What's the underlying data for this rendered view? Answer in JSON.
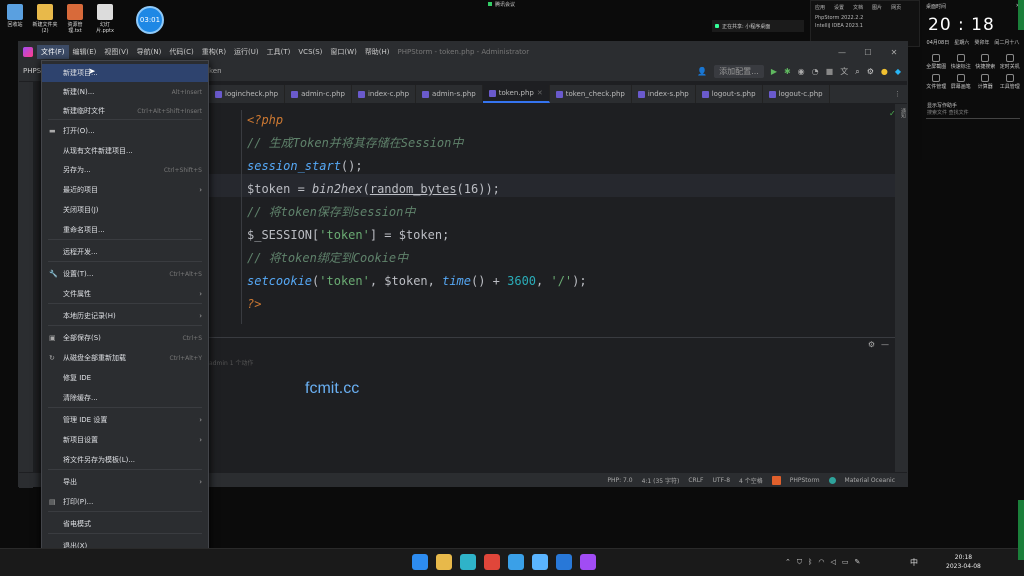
{
  "desktop": {
    "icons": [
      {
        "label": "回收站",
        "color": "#5aa0e0"
      },
      {
        "label": "新建文件夹(2)",
        "color": "#e8b94a"
      },
      {
        "label": "资源管理.txt",
        "color": "#d86a3a"
      },
      {
        "label": "幻灯片.pptx",
        "color": "#dcdcdc"
      }
    ],
    "clock_badge": "03:01",
    "top_status": "腾讯会议",
    "notify_text": "正在共享: 小程序桌面",
    "right_panel": {
      "tabs": [
        "应用",
        "设置",
        "文档",
        "图片",
        "网页"
      ],
      "lines": [
        "PhpStorm 2022.2.2",
        "IntelliJ IDEA 2023.1"
      ]
    },
    "widget": {
      "header_left": "桌面时间",
      "time": "20 : 18",
      "date": [
        "04月08日",
        "星期六",
        "癸卯年",
        "闰二月十八"
      ],
      "grid": [
        "全屏截图",
        "快速标注",
        "快捷搜索",
        "定时关机",
        "文件管理",
        "屏幕画笔",
        "计算器",
        "工具管理"
      ],
      "search_label": "显示写作助手",
      "search_sub": "搜索文件   查找文件"
    }
  },
  "window": {
    "title": "PHPStorm - token.php - Administrator",
    "menubar": [
      "文件(F)",
      "编辑(E)",
      "视图(V)",
      "导航(N)",
      "代码(C)",
      "重构(R)",
      "运行(U)",
      "工具(T)",
      "VCS(S)",
      "窗口(W)",
      "帮助(H)"
    ],
    "controls": [
      "—",
      "☐",
      "✕"
    ],
    "project_label": "PHPS",
    "breadcrumb": "ken",
    "toolbar_dropdown": "添加配置...",
    "tabs": [
      {
        "label": "logincheck.php"
      },
      {
        "label": "admin-c.php"
      },
      {
        "label": "index-c.php"
      },
      {
        "label": "admin-s.php"
      },
      {
        "label": "token.php"
      },
      {
        "label": "token_check.php"
      },
      {
        "label": "index-s.php"
      },
      {
        "label": "logout-s.php"
      },
      {
        "label": "logout-c.php"
      }
    ],
    "active_tab": "token.php",
    "right_strip": "通知",
    "status_items": [
      "PHP: 7.0",
      "4:1 (35 字符)",
      "CRLF",
      "UTF-8",
      "4 个空格",
      "PHPStorm",
      "Material Oceanic"
    ],
    "run_text": "admin 1 个动作",
    "watermark": "fcmit.cc"
  },
  "code": {
    "l1": "<?php",
    "l2": "// 生成Token并将其存储在Session中",
    "l3a": "session_start",
    "l3b": "();",
    "l4a": "$token = ",
    "l4b": "bin2hex",
    "l4c": "(",
    "l4d": "random_bytes",
    "l4e": "(16));",
    "l5": "// 将token保存到session中",
    "l6a": "$_SESSION[",
    "l6b": "'token'",
    "l6c": "] = $token;",
    "l7": "// 将token绑定到Cookie中",
    "l8a": "setcookie",
    "l8b": "(",
    "l8c": "'token'",
    "l8d": ", $token, ",
    "l8e": "time",
    "l8f": "() + ",
    "l8g": "3600",
    "l8h": ", ",
    "l8i": "'/'",
    "l8j": ");",
    "l9": "?>"
  },
  "menu": {
    "items": [
      {
        "label": "新建项目...",
        "shortcut": "",
        "arrow": ""
      },
      {
        "label": "新建(N)...",
        "shortcut": "Alt+Insert",
        "arrow": ""
      },
      {
        "label": "新建临时文件",
        "shortcut": "Ctrl+Alt+Shift+Insert",
        "arrow": ""
      },
      {
        "label": "打开(O)...",
        "shortcut": "",
        "arrow": ""
      },
      {
        "label": "从现有文件新建项目...",
        "shortcut": "",
        "arrow": ""
      },
      {
        "label": "另存为...",
        "shortcut": "Ctrl+Shift+S",
        "arrow": ""
      },
      {
        "label": "最近的项目",
        "shortcut": "",
        "arrow": "›"
      },
      {
        "label": "关闭项目(J)",
        "shortcut": "",
        "arrow": ""
      },
      {
        "label": "重命名项目...",
        "shortcut": "",
        "arrow": ""
      },
      {
        "label": "远程开发...",
        "shortcut": "",
        "arrow": ""
      },
      {
        "label": "设置(T)...",
        "shortcut": "Ctrl+Alt+S",
        "arrow": ""
      },
      {
        "label": "文件属性",
        "shortcut": "",
        "arrow": "›"
      },
      {
        "label": "本地历史记录(H)",
        "shortcut": "",
        "arrow": "›"
      },
      {
        "label": "全部保存(S)",
        "shortcut": "Ctrl+S",
        "arrow": ""
      },
      {
        "label": "从磁盘全部重新加载",
        "shortcut": "Ctrl+Alt+Y",
        "arrow": ""
      },
      {
        "label": "修复 IDE",
        "shortcut": "",
        "arrow": ""
      },
      {
        "label": "清除缓存...",
        "shortcut": "",
        "arrow": ""
      },
      {
        "label": "管理 IDE 设置",
        "shortcut": "",
        "arrow": "›"
      },
      {
        "label": "新项目设置",
        "shortcut": "",
        "arrow": "›"
      },
      {
        "label": "将文件另存为模板(L)...",
        "shortcut": "",
        "arrow": ""
      },
      {
        "label": "导出",
        "shortcut": "",
        "arrow": "›"
      },
      {
        "label": "打印(P)...",
        "shortcut": "",
        "arrow": ""
      },
      {
        "label": "省电模式",
        "shortcut": "",
        "arrow": ""
      },
      {
        "label": "退出(X)",
        "shortcut": "",
        "arrow": ""
      }
    ]
  },
  "taskbar": {
    "apps": [
      {
        "name": "windows",
        "color": "#2d8cf0"
      },
      {
        "name": "explorer",
        "color": "#e8b94a"
      },
      {
        "name": "edge",
        "color": "#2fb3c9"
      },
      {
        "name": "chrome",
        "color": "#e0463a"
      },
      {
        "name": "app5",
        "color": "#3aa0e8"
      },
      {
        "name": "app6",
        "color": "#5ab4ff"
      },
      {
        "name": "app7",
        "color": "#2878d8"
      },
      {
        "name": "phpstorm",
        "color": "#a14cf4"
      }
    ],
    "ime": "中",
    "time": "20:18",
    "date": "2023-04-08"
  },
  "colors": {
    "accent": "#3574f0",
    "menu_selected": "#2e436e",
    "watermark": "#6ab0f3"
  }
}
